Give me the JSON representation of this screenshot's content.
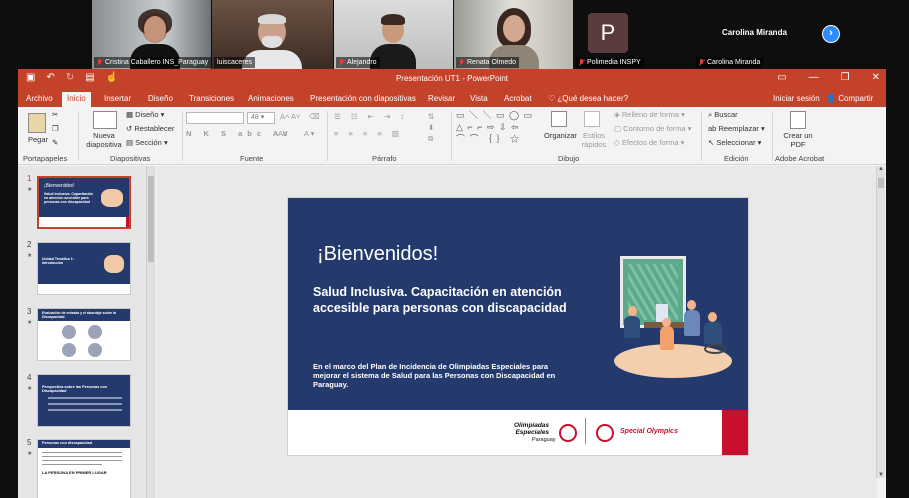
{
  "participants": [
    {
      "name": "Cristina Caballero INS_Paraguay",
      "muted": true
    },
    {
      "name": "luiscaceres",
      "muted": false
    },
    {
      "name": "Alejandro",
      "muted": true
    },
    {
      "name": "Renata Olmedo",
      "muted": true
    },
    {
      "name": "Polimedia INSPY",
      "muted": true,
      "initial": "P"
    },
    {
      "name": "Carolina Miranda",
      "muted": true
    }
  ],
  "app": {
    "window_title": "Presentación UT1 - PowerPoint",
    "tabs": [
      "Archivo",
      "Inicio",
      "Insertar",
      "Diseño",
      "Transiciones",
      "Animaciones",
      "Presentación con diapositivas",
      "Revisar",
      "Vista",
      "Acrobat"
    ],
    "selected_tab": "Inicio",
    "tell_me": "¿Qué desea hacer?",
    "sign_in": "Iniciar sesión",
    "share": "Compartir"
  },
  "ribbon": {
    "paste": "Pegar",
    "new_slide": "Nueva diapositiva",
    "layout": "Diseño",
    "reset": "Restablecer",
    "section": "Sección",
    "font_size": "48",
    "arrange": "Organizar",
    "quick_styles": "Estilos rápidos",
    "shape_fill": "Relleno de forma",
    "shape_outline": "Contorno de forma",
    "shape_effects": "Efectos de forma",
    "find": "Buscar",
    "replace": "Reemplazar",
    "select": "Seleccionar",
    "create_pdf": "Crear un PDF",
    "groups": [
      "Portapapeles",
      "Diapositivas",
      "Fuente",
      "Párrafo",
      "Dibujo",
      "Edición",
      "Adobe Acrobat"
    ]
  },
  "thumbnails": [
    {
      "number": "1",
      "title": "¡Bienvenidos!",
      "text": "Salud Inclusiva. Capacitación en atención accesible para personas con discapacidad"
    },
    {
      "number": "2",
      "title": "Unidad Temática 1: Introducción",
      "text": ""
    },
    {
      "number": "3",
      "title": "Evaluación de entrada y el abordaje sobre la Discapacidad",
      "text": ""
    },
    {
      "number": "4",
      "title": "Perspectiva sobre las Personas con Discapacidad",
      "text": ""
    },
    {
      "number": "5",
      "title": "Personas con discapacidad",
      "text": "LA PERSONA EN PRIMER LUGAR"
    }
  ],
  "slide": {
    "title": "¡Bienvenidos!",
    "subtitle": "Salud Inclusiva. Capacitación en atención accesible para personas con discapacidad",
    "body": "En el marco del Plan de Incidencia de Olimpiadas Especiales para mejorar el sistema de Salud para las Personas con Discapacidad en Paraguay.",
    "logo_left_line1": "Olimpiadas",
    "logo_left_line2": "Especiales",
    "logo_left_line3": "Paraguay",
    "logo_right": "Special Olympics"
  },
  "colors": {
    "ppt_accent": "#c4412a",
    "slide_navy": "#243a6d",
    "slide_red": "#c8102e",
    "zoom_active": "#30c540"
  }
}
